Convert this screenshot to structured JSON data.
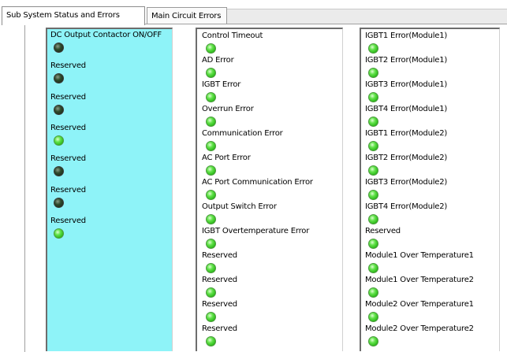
{
  "tabs": [
    {
      "label": "Sub System Status and Errors"
    },
    {
      "label": "Main Circuit Errors"
    }
  ],
  "colors": {
    "led_on": "#3fd12a",
    "led_off": "#253d23",
    "panel_cyan": "#8ef3f8"
  },
  "panels": [
    {
      "indicators": [
        {
          "label": "DC Output Contactor ON/OFF",
          "state": "off"
        },
        {
          "label": "Reserved",
          "state": "off"
        },
        {
          "label": "Reserved",
          "state": "off"
        },
        {
          "label": "Reserved",
          "state": "on"
        },
        {
          "label": "Reserved",
          "state": "off"
        },
        {
          "label": "Reserved",
          "state": "off"
        },
        {
          "label": "Reserved",
          "state": "on"
        }
      ]
    },
    {
      "indicators": [
        {
          "label": "Control Timeout",
          "state": "on"
        },
        {
          "label": "AD Error",
          "state": "on"
        },
        {
          "label": "IGBT Error",
          "state": "on"
        },
        {
          "label": "Overrun Error",
          "state": "on"
        },
        {
          "label": "Communication Error",
          "state": "on"
        },
        {
          "label": "AC Port Error",
          "state": "on"
        },
        {
          "label": "AC Port Communication Error",
          "state": "on"
        },
        {
          "label": "Output Switch Error",
          "state": "on"
        },
        {
          "label": "IGBT Overtemperature Error",
          "state": "on"
        },
        {
          "label": "Reserved",
          "state": "on"
        },
        {
          "label": "Reserved",
          "state": "on"
        },
        {
          "label": "Reserved",
          "state": "on"
        },
        {
          "label": "Reserved",
          "state": "on"
        }
      ]
    },
    {
      "indicators": [
        {
          "label": "IGBT1 Error(Module1)",
          "state": "on"
        },
        {
          "label": "IGBT2 Error(Module1)",
          "state": "on"
        },
        {
          "label": "IGBT3 Error(Module1)",
          "state": "on"
        },
        {
          "label": "IGBT4 Error(Module1)",
          "state": "on"
        },
        {
          "label": "IGBT1 Error(Module2)",
          "state": "on"
        },
        {
          "label": "IGBT2 Error(Module2)",
          "state": "on"
        },
        {
          "label": "IGBT3 Error(Module2)",
          "state": "on"
        },
        {
          "label": "IGBT4 Error(Module2)",
          "state": "on"
        },
        {
          "label": "Reserved",
          "state": "on"
        },
        {
          "label": "Module1 Over Temperature1",
          "state": "on"
        },
        {
          "label": "Module1 Over Temperature2",
          "state": "on"
        },
        {
          "label": "Module2 Over Temperature1",
          "state": "on"
        },
        {
          "label": "Module2 Over Temperature2",
          "state": "on"
        }
      ]
    }
  ]
}
